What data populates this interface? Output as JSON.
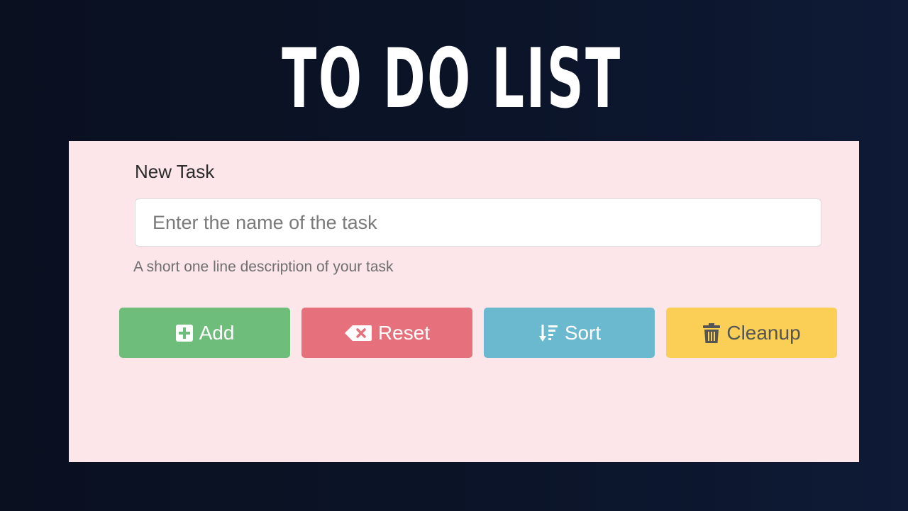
{
  "title": "TO DO LIST",
  "form": {
    "label": "New Task",
    "placeholder": "Enter the name of the task",
    "help": "A short one line description of your task"
  },
  "buttons": {
    "add": {
      "label": "Add",
      "icon": "plus-square-icon",
      "color": "#6fbd7a"
    },
    "reset": {
      "label": "Reset",
      "icon": "backspace-icon",
      "color": "#e6717c"
    },
    "sort": {
      "label": "Sort",
      "icon": "sort-down-icon",
      "color": "#6bb9cf"
    },
    "cleanup": {
      "label": "Cleanup",
      "icon": "trash-icon",
      "color": "#fbcf55"
    }
  }
}
